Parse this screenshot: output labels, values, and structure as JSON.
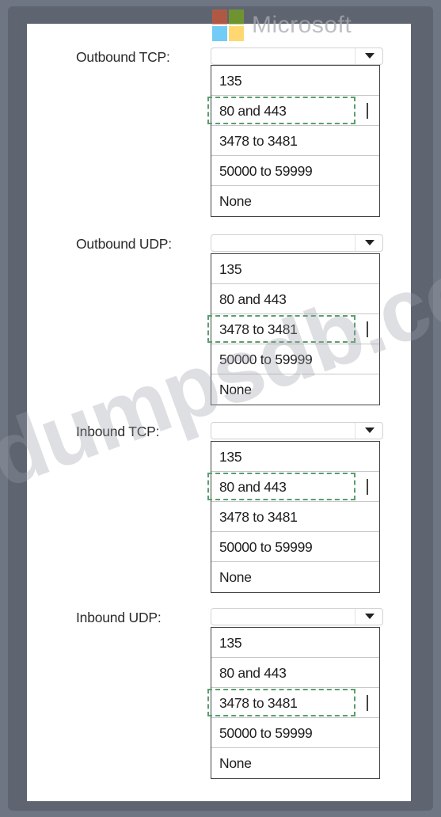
{
  "brand": {
    "logo_text": "Microsoft"
  },
  "watermark": "dumpsdb.com",
  "sections": [
    {
      "label": "Outbound TCP:",
      "options": [
        "135",
        "80 and 443",
        "3478 to 3481",
        "50000 to 59999",
        "None"
      ],
      "selected_index": 1
    },
    {
      "label": "Outbound UDP:",
      "options": [
        "135",
        "80 and 443",
        "3478 to 3481",
        "50000 to 59999",
        "None"
      ],
      "selected_index": 2
    },
    {
      "label": "Inbound TCP:",
      "options": [
        "135",
        "80 and 443",
        "3478 to 3481",
        "50000 to 59999",
        "None"
      ],
      "selected_index": 1
    },
    {
      "label": "Inbound UDP:",
      "options": [
        "135",
        "80 and 443",
        "3478 to 3481",
        "50000 to 59999",
        "None"
      ],
      "selected_index": 2
    }
  ]
}
